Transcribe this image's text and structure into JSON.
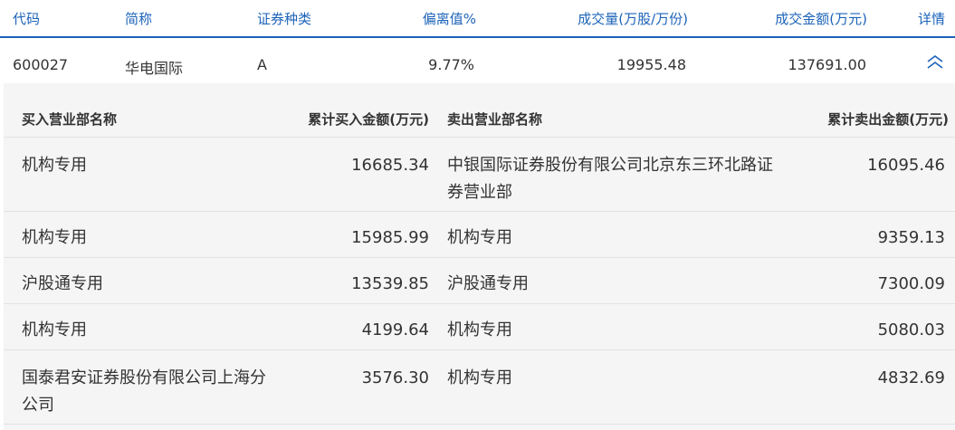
{
  "header": {
    "code": "代码",
    "name": "简称",
    "type": "证券种类",
    "deviation": "偏离值%",
    "volume": "成交量(万股/万份)",
    "amount": "成交金额(万元)",
    "details": "详情"
  },
  "stock": {
    "code": "600027",
    "name": "华电国际",
    "type": "A",
    "deviation": "9.77%",
    "volume": "19955.48",
    "amount": "137691.00",
    "toggle_icon": "double-chevron-up-icon"
  },
  "detail": {
    "headers": {
      "buy_dept": "买入营业部名称",
      "buy_amount": "累计买入金额(万元)",
      "sell_dept": "卖出营业部名称",
      "sell_amount": "累计卖出金额(万元)"
    },
    "rows": [
      {
        "buy_dept": "机构专用",
        "buy_amount": "16685.34",
        "sell_dept": "中银国际证券股份有限公司北京东三环北路证券营业部",
        "sell_amount": "16095.46"
      },
      {
        "buy_dept": "机构专用",
        "buy_amount": "15985.99",
        "sell_dept": "机构专用",
        "sell_amount": "9359.13"
      },
      {
        "buy_dept": "沪股通专用",
        "buy_amount": "13539.85",
        "sell_dept": "沪股通专用",
        "sell_amount": "7300.09"
      },
      {
        "buy_dept": "机构专用",
        "buy_amount": "4199.64",
        "sell_dept": "机构专用",
        "sell_amount": "5080.03"
      },
      {
        "buy_dept": "国泰君安证券股份有限公司上海分公司",
        "buy_amount": "3576.30",
        "sell_dept": "机构专用",
        "sell_amount": "4832.69"
      }
    ]
  },
  "colors": {
    "accent": "#1c63b8",
    "panel_bg": "#f5f5f5",
    "text": "#333333"
  }
}
